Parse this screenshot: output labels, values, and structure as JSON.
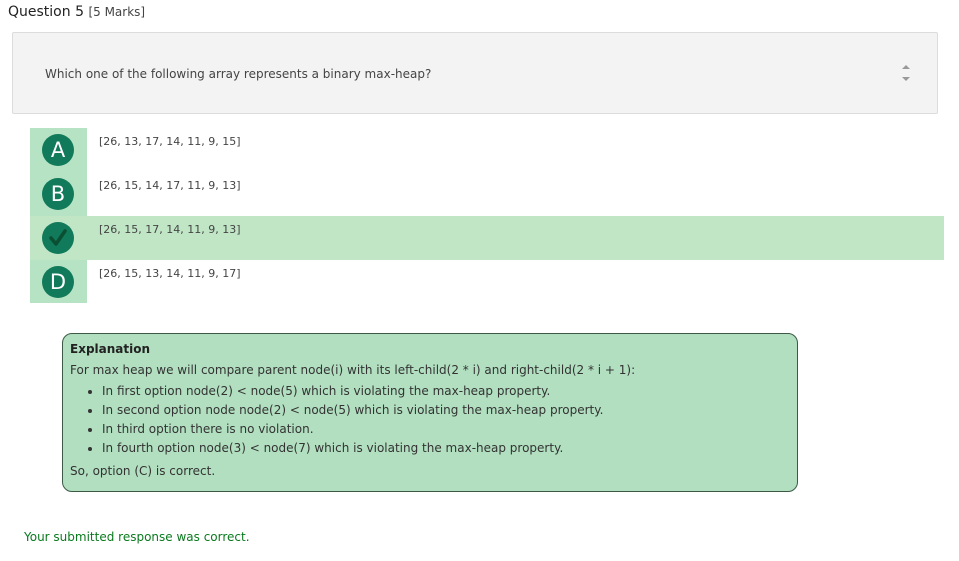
{
  "question": {
    "title": "Question 5",
    "marks": "[5 Marks]",
    "text": "Which one of the following array represents a binary max-heap?"
  },
  "options": [
    {
      "letter": "A",
      "text": "[26, 13, 17, 14, 11, 9, 15]",
      "selected": false
    },
    {
      "letter": "B",
      "text": "[26, 15, 14, 17, 11, 9, 13]",
      "selected": false
    },
    {
      "letter": "C",
      "text": "[26, 15, 17, 14, 11, 9, 13]",
      "selected": true,
      "icon": "check-icon"
    },
    {
      "letter": "D",
      "text": "[26, 15, 13, 14, 11, 9, 17]",
      "selected": false
    }
  ],
  "explanation": {
    "title": "Explanation",
    "intro": "For max heap we will compare parent node(i) with its left-child(2 * i) and right-child(2 * i + 1):",
    "points": [
      "In first option node(2) < node(5) which is violating the max-heap property.",
      "In second option node node(2) < node(5) which is violating the max-heap property.",
      "In third option there is no violation.",
      "In fourth option node(3) < node(7) which is violating the max-heap property."
    ],
    "conclusion": "So, option (C) is correct."
  },
  "result": "Your submitted response was correct.",
  "colors": {
    "accent": "#107a5a",
    "selected_row": "#c0e6c6",
    "option_strip": "#b5e3c3",
    "explanation_bg": "#b1dfc0",
    "success_text": "#0a7a1e"
  }
}
